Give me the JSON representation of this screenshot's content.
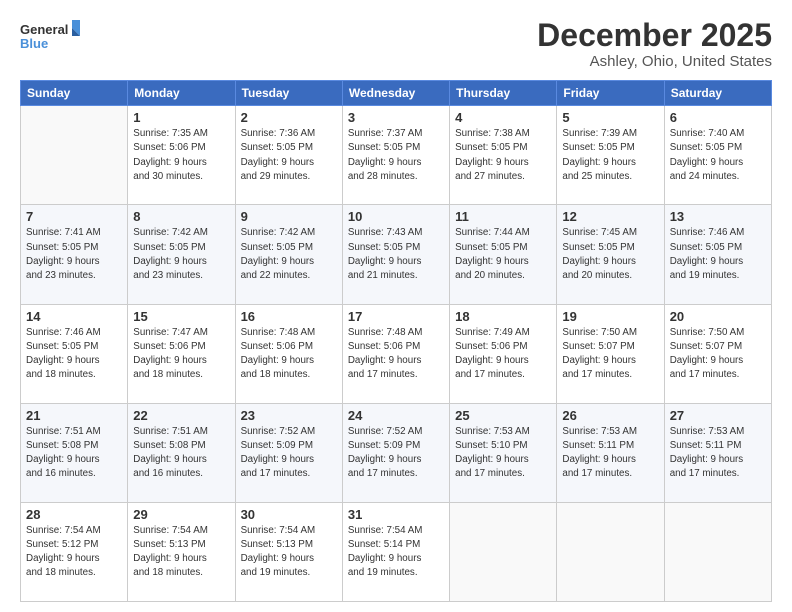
{
  "logo": {
    "line1": "General",
    "line2": "Blue"
  },
  "title": "December 2025",
  "subtitle": "Ashley, Ohio, United States",
  "weekdays": [
    "Sunday",
    "Monday",
    "Tuesday",
    "Wednesday",
    "Thursday",
    "Friday",
    "Saturday"
  ],
  "weeks": [
    [
      {
        "day": "",
        "info": ""
      },
      {
        "day": "1",
        "info": "Sunrise: 7:35 AM\nSunset: 5:06 PM\nDaylight: 9 hours\nand 30 minutes."
      },
      {
        "day": "2",
        "info": "Sunrise: 7:36 AM\nSunset: 5:05 PM\nDaylight: 9 hours\nand 29 minutes."
      },
      {
        "day": "3",
        "info": "Sunrise: 7:37 AM\nSunset: 5:05 PM\nDaylight: 9 hours\nand 28 minutes."
      },
      {
        "day": "4",
        "info": "Sunrise: 7:38 AM\nSunset: 5:05 PM\nDaylight: 9 hours\nand 27 minutes."
      },
      {
        "day": "5",
        "info": "Sunrise: 7:39 AM\nSunset: 5:05 PM\nDaylight: 9 hours\nand 25 minutes."
      },
      {
        "day": "6",
        "info": "Sunrise: 7:40 AM\nSunset: 5:05 PM\nDaylight: 9 hours\nand 24 minutes."
      }
    ],
    [
      {
        "day": "7",
        "info": "Sunrise: 7:41 AM\nSunset: 5:05 PM\nDaylight: 9 hours\nand 23 minutes."
      },
      {
        "day": "8",
        "info": "Sunrise: 7:42 AM\nSunset: 5:05 PM\nDaylight: 9 hours\nand 23 minutes."
      },
      {
        "day": "9",
        "info": "Sunrise: 7:42 AM\nSunset: 5:05 PM\nDaylight: 9 hours\nand 22 minutes."
      },
      {
        "day": "10",
        "info": "Sunrise: 7:43 AM\nSunset: 5:05 PM\nDaylight: 9 hours\nand 21 minutes."
      },
      {
        "day": "11",
        "info": "Sunrise: 7:44 AM\nSunset: 5:05 PM\nDaylight: 9 hours\nand 20 minutes."
      },
      {
        "day": "12",
        "info": "Sunrise: 7:45 AM\nSunset: 5:05 PM\nDaylight: 9 hours\nand 20 minutes."
      },
      {
        "day": "13",
        "info": "Sunrise: 7:46 AM\nSunset: 5:05 PM\nDaylight: 9 hours\nand 19 minutes."
      }
    ],
    [
      {
        "day": "14",
        "info": "Sunrise: 7:46 AM\nSunset: 5:05 PM\nDaylight: 9 hours\nand 18 minutes."
      },
      {
        "day": "15",
        "info": "Sunrise: 7:47 AM\nSunset: 5:06 PM\nDaylight: 9 hours\nand 18 minutes."
      },
      {
        "day": "16",
        "info": "Sunrise: 7:48 AM\nSunset: 5:06 PM\nDaylight: 9 hours\nand 18 minutes."
      },
      {
        "day": "17",
        "info": "Sunrise: 7:48 AM\nSunset: 5:06 PM\nDaylight: 9 hours\nand 17 minutes."
      },
      {
        "day": "18",
        "info": "Sunrise: 7:49 AM\nSunset: 5:06 PM\nDaylight: 9 hours\nand 17 minutes."
      },
      {
        "day": "19",
        "info": "Sunrise: 7:50 AM\nSunset: 5:07 PM\nDaylight: 9 hours\nand 17 minutes."
      },
      {
        "day": "20",
        "info": "Sunrise: 7:50 AM\nSunset: 5:07 PM\nDaylight: 9 hours\nand 17 minutes."
      }
    ],
    [
      {
        "day": "21",
        "info": "Sunrise: 7:51 AM\nSunset: 5:08 PM\nDaylight: 9 hours\nand 16 minutes."
      },
      {
        "day": "22",
        "info": "Sunrise: 7:51 AM\nSunset: 5:08 PM\nDaylight: 9 hours\nand 16 minutes."
      },
      {
        "day": "23",
        "info": "Sunrise: 7:52 AM\nSunset: 5:09 PM\nDaylight: 9 hours\nand 17 minutes."
      },
      {
        "day": "24",
        "info": "Sunrise: 7:52 AM\nSunset: 5:09 PM\nDaylight: 9 hours\nand 17 minutes."
      },
      {
        "day": "25",
        "info": "Sunrise: 7:53 AM\nSunset: 5:10 PM\nDaylight: 9 hours\nand 17 minutes."
      },
      {
        "day": "26",
        "info": "Sunrise: 7:53 AM\nSunset: 5:11 PM\nDaylight: 9 hours\nand 17 minutes."
      },
      {
        "day": "27",
        "info": "Sunrise: 7:53 AM\nSunset: 5:11 PM\nDaylight: 9 hours\nand 17 minutes."
      }
    ],
    [
      {
        "day": "28",
        "info": "Sunrise: 7:54 AM\nSunset: 5:12 PM\nDaylight: 9 hours\nand 18 minutes."
      },
      {
        "day": "29",
        "info": "Sunrise: 7:54 AM\nSunset: 5:13 PM\nDaylight: 9 hours\nand 18 minutes."
      },
      {
        "day": "30",
        "info": "Sunrise: 7:54 AM\nSunset: 5:13 PM\nDaylight: 9 hours\nand 19 minutes."
      },
      {
        "day": "31",
        "info": "Sunrise: 7:54 AM\nSunset: 5:14 PM\nDaylight: 9 hours\nand 19 minutes."
      },
      {
        "day": "",
        "info": ""
      },
      {
        "day": "",
        "info": ""
      },
      {
        "day": "",
        "info": ""
      }
    ]
  ]
}
